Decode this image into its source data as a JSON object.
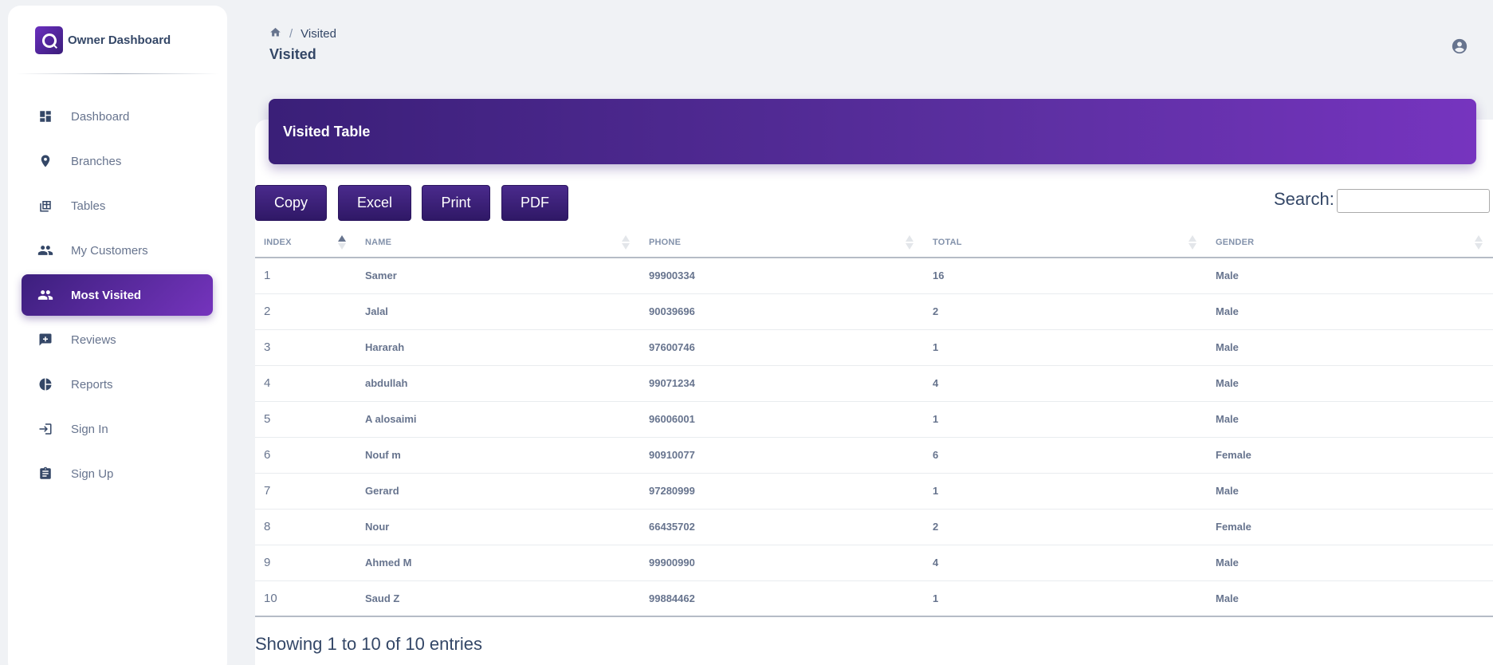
{
  "sidebar": {
    "brand": "Owner Dashboard",
    "items": [
      {
        "label": "Dashboard",
        "icon": "dashboard-icon"
      },
      {
        "label": "Branches",
        "icon": "location-pin-icon"
      },
      {
        "label": "Tables",
        "icon": "table-icon"
      },
      {
        "label": "My Customers",
        "icon": "people-icon"
      },
      {
        "label": "Most Visited",
        "icon": "people-icon",
        "active": true
      },
      {
        "label": "Reviews",
        "icon": "review-icon"
      },
      {
        "label": "Reports",
        "icon": "pie-chart-icon"
      },
      {
        "label": "Sign In",
        "icon": "login-icon"
      },
      {
        "label": "Sign Up",
        "icon": "clipboard-icon"
      }
    ]
  },
  "header": {
    "breadcrumb_current": "Visited",
    "title": "Visited"
  },
  "card": {
    "title": "Visited Table",
    "buttons": {
      "copy": "Copy",
      "excel": "Excel",
      "print": "Print",
      "pdf": "PDF"
    },
    "search_label": "Search:",
    "search_value": ""
  },
  "table": {
    "columns": [
      "INDEX",
      "NAME",
      "PHONE",
      "TOTAL",
      "GENDER"
    ],
    "rows": [
      {
        "index": "1",
        "name": "Samer",
        "phone": "99900334",
        "total": "16",
        "gender": "Male"
      },
      {
        "index": "2",
        "name": "Jalal",
        "phone": "90039696",
        "total": "2",
        "gender": "Male"
      },
      {
        "index": "3",
        "name": "Hararah",
        "phone": "97600746",
        "total": "1",
        "gender": "Male"
      },
      {
        "index": "4",
        "name": "abdullah",
        "phone": "99071234",
        "total": "4",
        "gender": "Male"
      },
      {
        "index": "5",
        "name": "A alosaimi",
        "phone": "96006001",
        "total": "1",
        "gender": "Male"
      },
      {
        "index": "6",
        "name": "Nouf m",
        "phone": "90910077",
        "total": "6",
        "gender": "Female"
      },
      {
        "index": "7",
        "name": "Gerard",
        "phone": "97280999",
        "total": "1",
        "gender": "Male"
      },
      {
        "index": "8",
        "name": "Nour",
        "phone": "66435702",
        "total": "2",
        "gender": "Female"
      },
      {
        "index": "9",
        "name": "Ahmed M",
        "phone": "99900990",
        "total": "4",
        "gender": "Male"
      },
      {
        "index": "10",
        "name": "Saud Z",
        "phone": "99884462",
        "total": "1",
        "gender": "Male"
      }
    ],
    "info": "Showing 1 to 10 of 10 entries"
  },
  "colors": {
    "accent_dark": "#3a1f78",
    "accent_light": "#7634bf",
    "text": "#344767",
    "muted": "#67748e"
  }
}
